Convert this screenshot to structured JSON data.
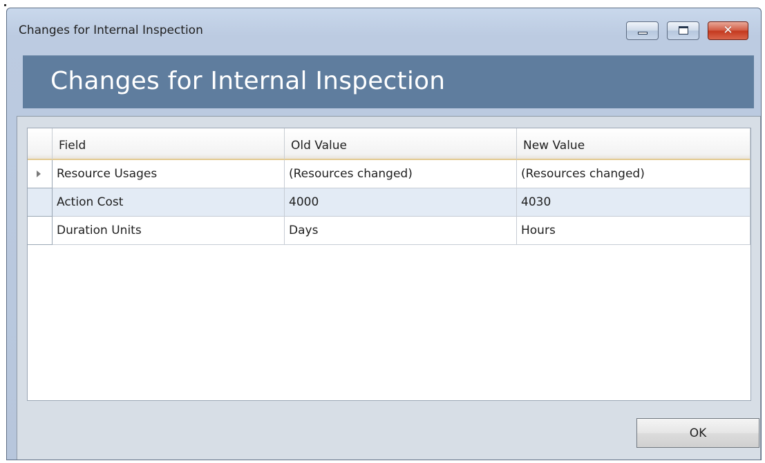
{
  "window": {
    "title": "Changes for Internal Inspection",
    "controls": {
      "minimize_icon": "minimize-icon",
      "maximize_icon": "maximize-icon",
      "close_icon": "close-icon",
      "close_glyph": "✕"
    }
  },
  "banner": {
    "title": "Changes for Internal Inspection"
  },
  "grid": {
    "columns": [
      "Field",
      "Old Value",
      "New Value"
    ],
    "rows": [
      {
        "field": "Resource Usages",
        "old_value": "(Resources changed)",
        "new_value": "(Resources changed)",
        "current": true
      },
      {
        "field": "Action Cost",
        "old_value": "4000",
        "new_value": "4030",
        "current": false
      },
      {
        "field": "Duration Units",
        "old_value": "Days",
        "new_value": "Hours",
        "current": false
      }
    ]
  },
  "footer": {
    "ok_label": "OK"
  },
  "colors": {
    "banner": "#5f7d9e",
    "alt_row": "#e3ebf5",
    "header_underline": "#e3c98f",
    "close_button": "#c4391f"
  }
}
